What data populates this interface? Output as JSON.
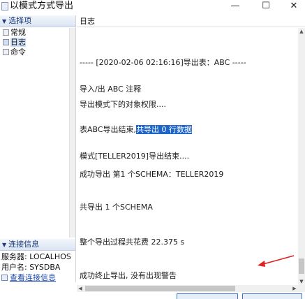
{
  "window": {
    "title": "以模式方式导出",
    "controls": [
      "—",
      "☐",
      "✕"
    ]
  },
  "left": {
    "section1_title": "选择项",
    "tree_items": [
      {
        "label": "常规",
        "selected": false
      },
      {
        "label": "日志",
        "selected": true
      },
      {
        "label": "命令",
        "selected": false
      }
    ],
    "section2_title": "连接信息",
    "server": "服务器: LOCALHOS",
    "user": "用户名: SYSDBA",
    "view_link": "查看连接信息"
  },
  "right": {
    "tab_label": "日志",
    "log_lines": [
      "----- [2020-02-06 02:16:16]导出表：ABC -----",
      "导入/出 ABC 注释",
      "导出模式下的对象权限....",
      "表ABC导出结束,",
      "共导出 0 行数据",
      "模式[TELLER2019]导出结束....",
      "成功导出 第1 个SCHEMA：TELLER2019",
      "共导出 1 个SCHEMA",
      "整个导出过程共花费   22.375 s",
      "成功终止导出, 没有出现警告"
    ]
  },
  "colors": {
    "highlight": "#1e66c8",
    "annotation_arrow": "#e02020",
    "link": "#1e49b2"
  }
}
